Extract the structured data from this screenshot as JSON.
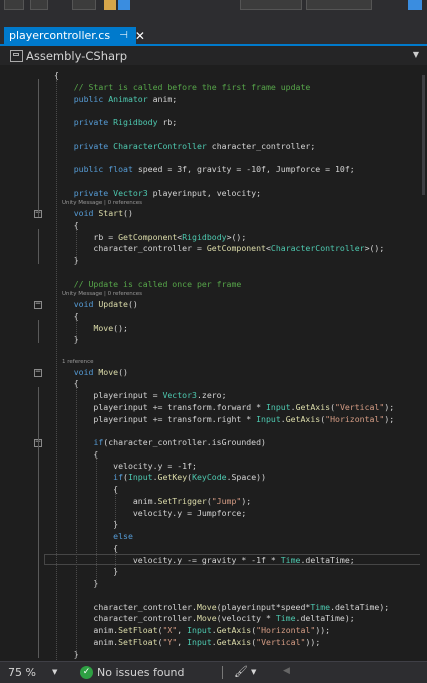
{
  "tab": {
    "title": "playercontroller.cs",
    "pin_icon": "pin-icon",
    "close_icon": "close-icon"
  },
  "nav": {
    "project": "Assembly-CSharp",
    "project_icon": "csharp-project-icon"
  },
  "code_lines": [
    "{",
    "    // Start is called before the first frame update",
    "    public Animator anim;",
    "",
    "    private Rigidbody rb;",
    "",
    "    private CharacterController character_controller;",
    "",
    "    public float speed = 3f, gravity = -10f, Jumpforce = 10f;",
    "",
    "    private Vector3 playerinput, velocity;",
    "    void Start()",
    "    {",
    "        rb = GetComponent<Rigidbody>();",
    "        character_controller = GetComponent<CharacterController>();",
    "    }",
    "",
    "    // Update is called once per frame",
    "    void Update()",
    "    {",
    "        Move();",
    "    }",
    "",
    "    void Move()",
    "    {",
    "        playerinput = Vector3.zero;",
    "        playerinput += transform.forward * Input.GetAxis(\"Vertical\");",
    "        playerinput += transform.right * Input.GetAxis(\"Horizontal\");",
    "",
    "        if(character_controller.isGrounded)",
    "        {",
    "            velocity.y = -1f;",
    "            if(Input.GetKey(KeyCode.Space))",
    "            {",
    "                anim.SetTrigger(\"Jump\");",
    "                velocity.y = Jumpforce;",
    "            }",
    "            else",
    "            {",
    "                velocity.y -= gravity * -1f * Time.deltaTime;",
    "            }",
    "        }",
    "",
    "        character_controller.Move(playerinput*speed*Time.deltaTime);",
    "        character_controller.Move(velocity * Time.deltaTime);",
    "        anim.SetFloat(\"X\", Input.GetAxis(\"Horizontal\"));",
    "        anim.SetFloat(\"Y\", Input.GetAxis(\"Vertical\"));",
    "    }",
    "}"
  ],
  "codelens": {
    "start": "Unity Message | 0 references",
    "update": "Unity Message | 0 references",
    "move": "1 reference"
  },
  "status": {
    "zoom": "75 %",
    "issues_icon": "check-circle-icon",
    "issues": "No issues found",
    "cleanup_icon": "brush-icon"
  }
}
